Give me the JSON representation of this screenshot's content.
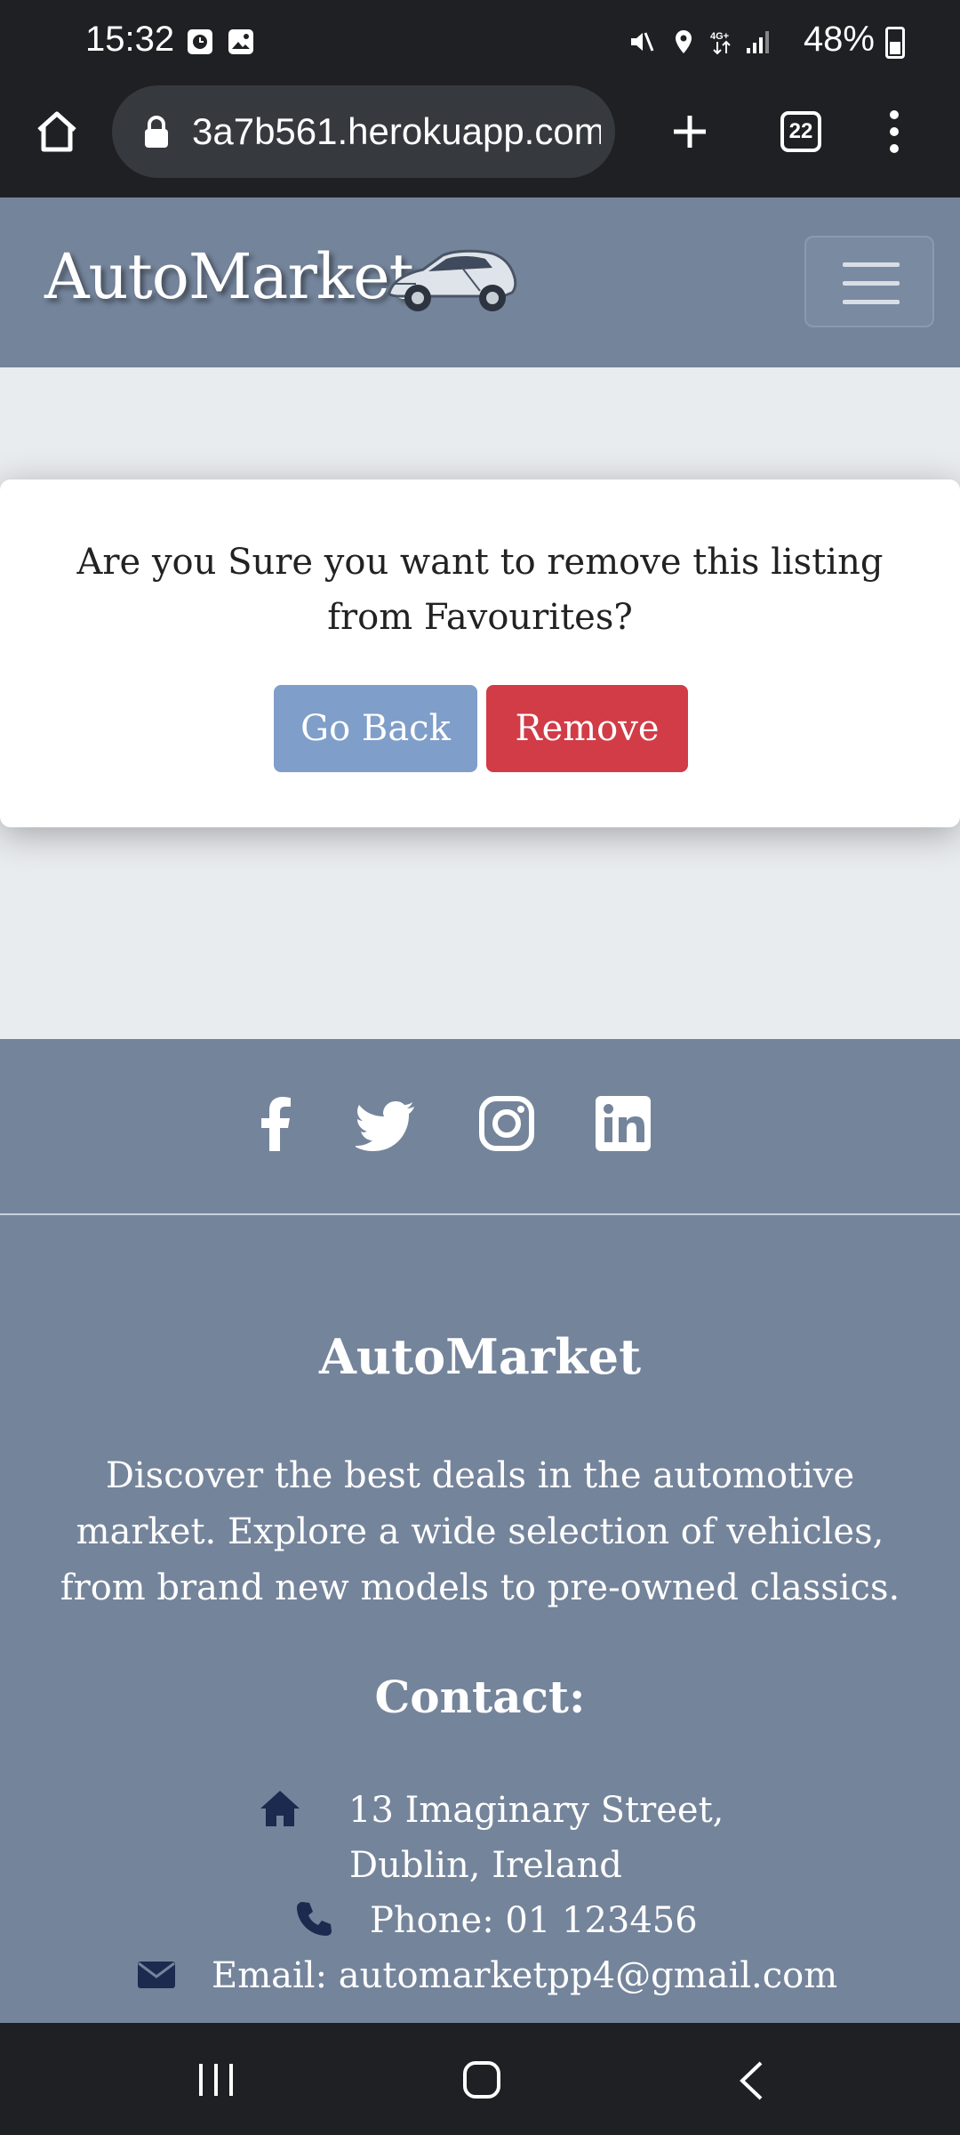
{
  "status_bar": {
    "time": "15:32",
    "battery": "48%"
  },
  "browser": {
    "url": "3a7b561.herokuapp.com",
    "tab_count": "22"
  },
  "site": {
    "brand": "AutoMarket"
  },
  "modal": {
    "message": "Are you Sure you want to remove this listing from Favourites?",
    "back_label": "Go Back",
    "remove_label": "Remove"
  },
  "footer": {
    "title": "AutoMarket",
    "description": "Discover the best deals in the automotive market. Explore a wide selection of vehicles, from brand new models to pre-owned classics.",
    "contact_title": "Contact:",
    "address_line1": "13 Imaginary Street,",
    "address_line2": "Dublin, Ireland",
    "phone": "Phone: 01 123456",
    "email": "Email: automarketpp4@gmail.com",
    "social_icons": [
      "facebook-icon",
      "twitter-icon",
      "instagram-icon",
      "linkedin-icon"
    ]
  },
  "colors": {
    "navbar": "#74849b",
    "go_back": "#7f9ec9",
    "remove": "#d13c47",
    "contact_icon": "#1b2a4e"
  }
}
